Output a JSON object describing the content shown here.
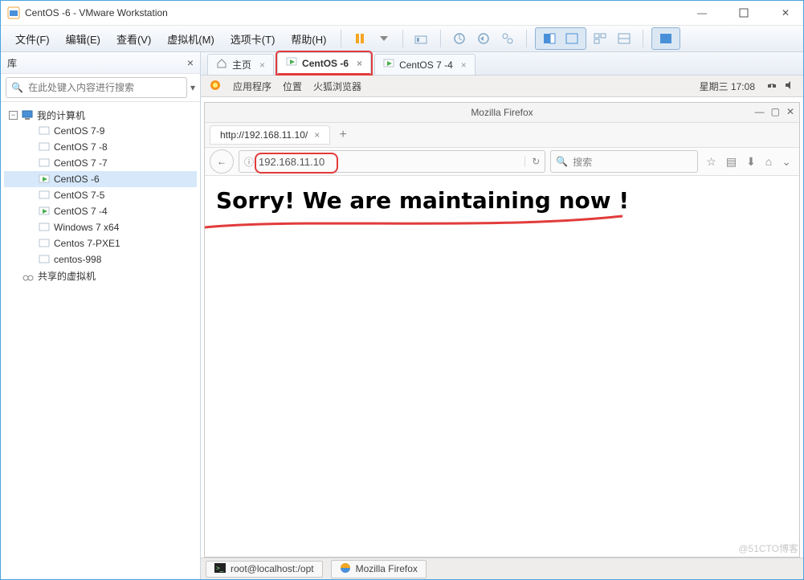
{
  "window": {
    "title": "CentOS -6 - VMware Workstation"
  },
  "menu": {
    "file": "文件(F)",
    "edit": "编辑(E)",
    "view": "查看(V)",
    "vm": "虚拟机(M)",
    "tabs": "选项卡(T)",
    "help": "帮助(H)"
  },
  "sidebar": {
    "title": "库",
    "search_placeholder": "在此处键入内容进行搜索",
    "root": "我的计算机",
    "items": [
      {
        "label": "CentOS 7-9"
      },
      {
        "label": "CentOS 7 -8"
      },
      {
        "label": "CentOS 7 -7"
      },
      {
        "label": "CentOS -6"
      },
      {
        "label": "CentOS 7-5"
      },
      {
        "label": "CentOS 7 -4"
      },
      {
        "label": "Windows 7 x64"
      },
      {
        "label": "Centos 7-PXE1"
      },
      {
        "label": "centos-998"
      }
    ],
    "shared": "共享的虚拟机"
  },
  "doc_tabs": [
    {
      "label": "主页",
      "icon": "home"
    },
    {
      "label": "CentOS -6",
      "icon": "vm",
      "active": true,
      "highlight": true
    },
    {
      "label": "CentOS 7 -4",
      "icon": "vm"
    }
  ],
  "gnome": {
    "apps": "应用程序",
    "places": "位置",
    "firefox": "火狐浏览器",
    "clock": "星期三 17:08"
  },
  "firefox": {
    "title": "Mozilla Firefox",
    "tab": "http://192.168.11.10/",
    "url": "192.168.11.10",
    "search_placeholder": "搜索",
    "page_headline": "Sorry! We are maintaining now !"
  },
  "taskbar": {
    "terminal": "root@localhost:/opt",
    "firefox": "Mozilla Firefox"
  },
  "watermark": "@51CTO博客"
}
